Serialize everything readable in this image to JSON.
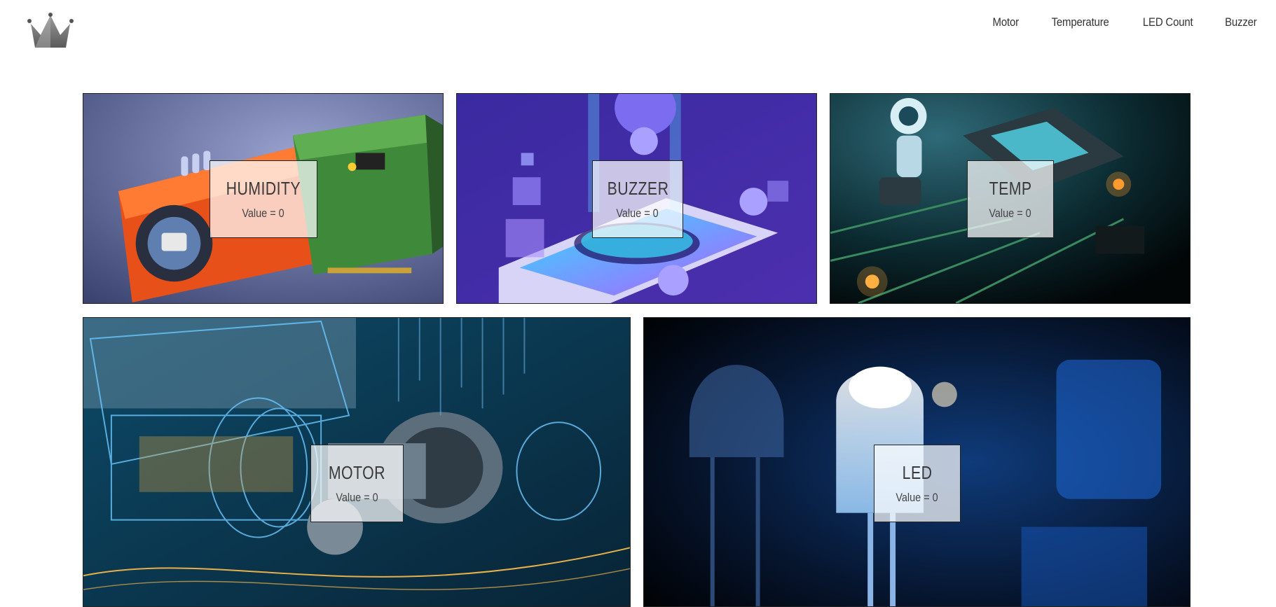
{
  "header": {
    "logo_icon": "crown-icon",
    "nav": [
      {
        "label": "Motor"
      },
      {
        "label": "Temperature"
      },
      {
        "label": "LED Count"
      },
      {
        "label": "Buzzer"
      }
    ]
  },
  "cards": {
    "humidity": {
      "title": "HUMIDITY",
      "value_text": "Value = 0"
    },
    "buzzer": {
      "title": "BUZZER",
      "value_text": "Value = 0"
    },
    "temp": {
      "title": "TEMP",
      "value_text": "Value = 0"
    },
    "motor": {
      "title": "MOTOR",
      "value_text": "Value = 0"
    },
    "led": {
      "title": "LED",
      "value_text": "Value = 0"
    }
  }
}
